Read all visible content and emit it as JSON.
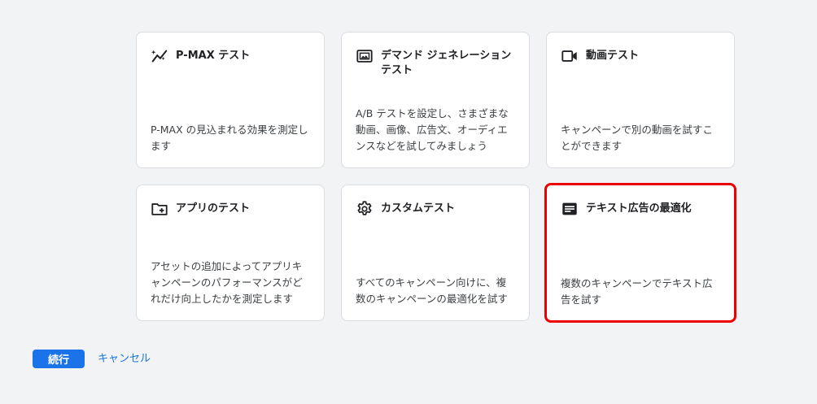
{
  "cards": [
    {
      "icon": "sparkline-icon",
      "title": "P-MAX テスト",
      "description": "P-MAX の見込まれる効果を測定します",
      "selected": false
    },
    {
      "icon": "image-frame-icon",
      "title": "デマンド ジェネレーション テスト",
      "description": "A/B テストを設定し、さまざまな動画、画像、広告文、オーディエンスなどを試してみましょう",
      "selected": false
    },
    {
      "icon": "video-camera-icon",
      "title": "動画テスト",
      "description": "キャンペーンで別の動画を試すことができます",
      "selected": false
    },
    {
      "icon": "folder-add-icon",
      "title": "アプリのテスト",
      "description": "アセットの追加によってアプリキャンペーンのパフォーマンスがどれだけ向上したかを測定します",
      "selected": false
    },
    {
      "icon": "gear-icon",
      "title": "カスタムテスト",
      "description": "すべてのキャンペーン向けに、複数のキャンペーンの最適化を試す",
      "selected": false
    },
    {
      "icon": "text-ad-icon",
      "title": "テキスト広告の最適化",
      "description": "複数のキャンペーンでテキスト広告を試す",
      "selected": true
    }
  ],
  "actions": {
    "continue_label": "続行",
    "cancel_label": "キャンセル"
  },
  "colors": {
    "accent": "#1a73e8",
    "selected_border": "#ee0000",
    "background": "#f1f3f4"
  }
}
